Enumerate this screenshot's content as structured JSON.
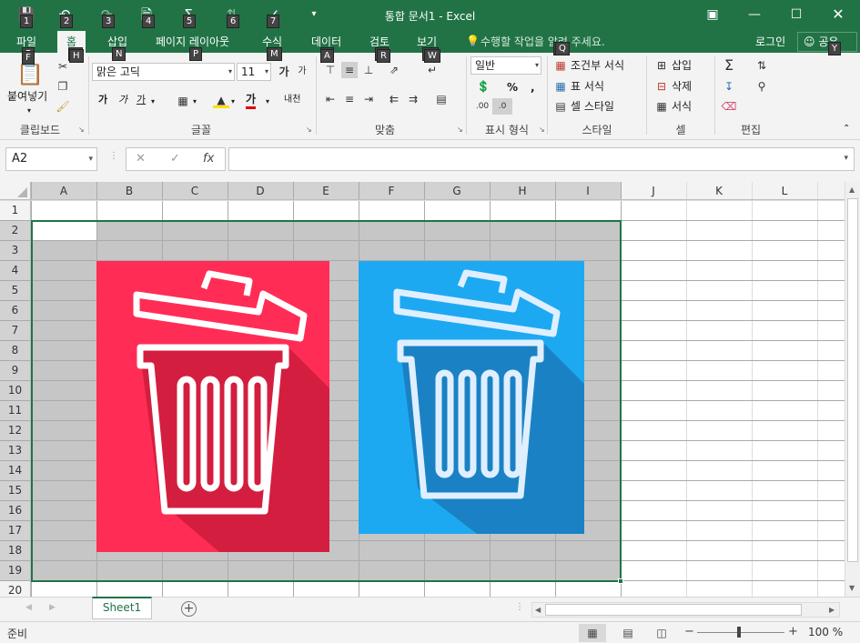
{
  "window": {
    "title": "통합 문서1 - Excel",
    "quick_access": {
      "save_key": "1",
      "undo_key": "2",
      "redo_key": "3",
      "k4": "4",
      "k5": "5",
      "k6": "6",
      "k7": "7"
    }
  },
  "tabs": [
    {
      "label": "파일",
      "key": "F"
    },
    {
      "label": "홈",
      "key": "H"
    },
    {
      "label": "삽입",
      "key": "N"
    },
    {
      "label": "페이지 레이아웃",
      "key": "P"
    },
    {
      "label": "수식",
      "key": "M"
    },
    {
      "label": "데이터",
      "key": "A"
    },
    {
      "label": "검토",
      "key": "R"
    },
    {
      "label": "보기",
      "key": "W"
    }
  ],
  "tell_me": "수행할 작업을 알려 주세요.",
  "tell_me_key": "Q",
  "login": "로그인",
  "share": "공유",
  "share_key": "Y",
  "ribbon": {
    "clipboard": {
      "label": "클립보드",
      "paste": "붙여넣기"
    },
    "font": {
      "label": "글꼴",
      "name": "맑은 고딕",
      "size": "11",
      "bold": "가",
      "italic": "가",
      "underline": "가",
      "font_color": "가",
      "phonetic": "내천"
    },
    "align": {
      "label": "맞춤"
    },
    "number": {
      "label": "표시 형식",
      "format": "일반"
    },
    "styles": {
      "label": "스타일",
      "conditional": "조건부 서식",
      "table": "표 서식",
      "cell_style": "셀 스타일"
    },
    "cells": {
      "label": "셀",
      "insert": "삽입",
      "delete": "삭제",
      "format": "서식"
    },
    "editing": {
      "label": "편집"
    }
  },
  "formula_bar": {
    "name_box": "A2",
    "fx": "fx",
    "value": ""
  },
  "sheet": {
    "columns": [
      "A",
      "B",
      "C",
      "D",
      "E",
      "F",
      "G",
      "H",
      "I",
      "J",
      "K",
      "L"
    ],
    "rows": [
      "1",
      "2",
      "3",
      "4",
      "5",
      "6",
      "7",
      "8",
      "9",
      "10",
      "11",
      "12",
      "13",
      "14",
      "15",
      "16",
      "17",
      "18",
      "19",
      "20"
    ],
    "selected_range": "A2:I19",
    "active_cell": "A2",
    "images": [
      {
        "name": "trash-icon-red",
        "background": "#ff2d55",
        "shadow": "#d41e3f",
        "stroke": "#ffffff"
      },
      {
        "name": "trash-icon-blue",
        "background": "#1da9f2",
        "shadow": "#1a82c4",
        "stroke": "#dfefff"
      }
    ]
  },
  "sheet_tabs": [
    "Sheet1"
  ],
  "status": {
    "text": "준비",
    "zoom": "100 %"
  }
}
